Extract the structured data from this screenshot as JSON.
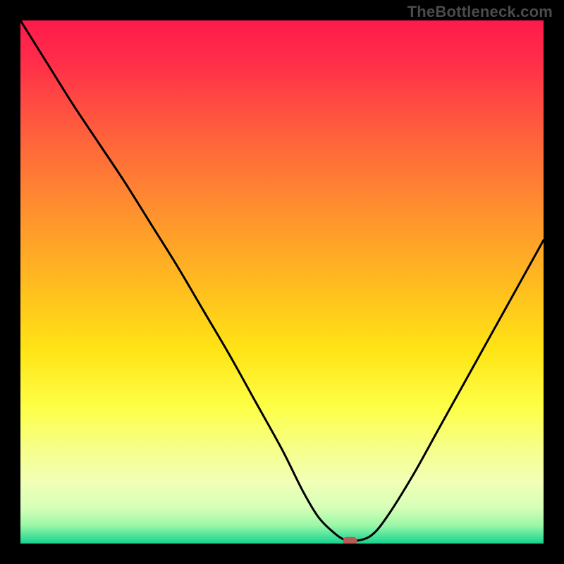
{
  "watermark": "TheBottleneck.com",
  "chart_data": {
    "type": "line",
    "title": "",
    "xlabel": "",
    "ylabel": "",
    "xlim": [
      0,
      100
    ],
    "ylim": [
      0,
      100
    ],
    "grid": false,
    "legend": false,
    "series": [
      {
        "name": "bottleneck-curve",
        "x": [
          0,
          5,
          10,
          15,
          20,
          25,
          30,
          35,
          40,
          45,
          50,
          54,
          57,
          60,
          62,
          64,
          67,
          70,
          75,
          80,
          85,
          90,
          95,
          100
        ],
        "values": [
          100,
          92,
          84,
          76.5,
          69,
          61,
          53,
          44.5,
          36,
          27,
          18,
          10,
          5,
          2,
          0.7,
          0.5,
          1.5,
          5,
          13,
          22,
          31,
          40,
          49,
          58
        ]
      }
    ],
    "marker": {
      "x": 63,
      "y": 0.5
    },
    "gradient_stops": [
      {
        "offset": 0,
        "color": "#ff1a4b"
      },
      {
        "offset": 0.08,
        "color": "#ff2e49"
      },
      {
        "offset": 0.2,
        "color": "#ff5a3e"
      },
      {
        "offset": 0.35,
        "color": "#ff8c30"
      },
      {
        "offset": 0.5,
        "color": "#ffba20"
      },
      {
        "offset": 0.63,
        "color": "#ffe415"
      },
      {
        "offset": 0.74,
        "color": "#fdff47"
      },
      {
        "offset": 0.82,
        "color": "#f6ff8a"
      },
      {
        "offset": 0.88,
        "color": "#f2ffb5"
      },
      {
        "offset": 0.93,
        "color": "#d8ffb8"
      },
      {
        "offset": 0.965,
        "color": "#9cf7a8"
      },
      {
        "offset": 0.985,
        "color": "#4de39a"
      },
      {
        "offset": 1.0,
        "color": "#18d28d"
      }
    ]
  }
}
